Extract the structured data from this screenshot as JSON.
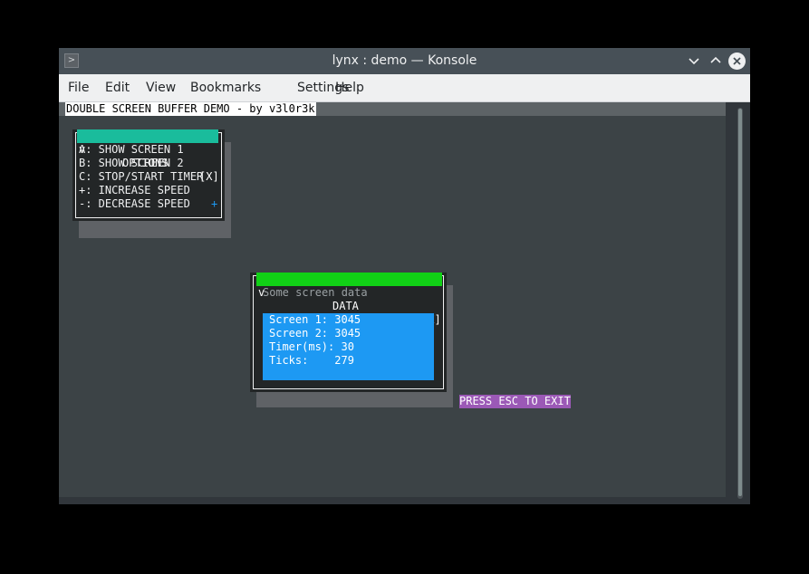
{
  "window": {
    "title": "lynx : demo — Konsole",
    "app_icon": "terminal-prompt-icon",
    "min_icon": "chevron-down-icon",
    "max_icon": "chevron-up-icon",
    "close_label": "✕",
    "min_label": "⌄",
    "max_label": "⌃"
  },
  "menu": [
    "File",
    "Edit",
    "View",
    "Bookmarks",
    "Settings",
    "Help"
  ],
  "terminal": {
    "banner": "DOUBLE SCREEN BUFFER DEMO - by v3l0r3k",
    "options_panel": {
      "title_left": "v",
      "title": "OPTIONS",
      "title_right": "[X]",
      "accent_color": "#1abc9c",
      "items": [
        "A: SHOW SCREEN 1",
        "B: SHOW SCREEN 2",
        "C: STOP/START TIMER",
        "+: INCREASE SPEED",
        "-: DECREASE SPEED"
      ],
      "marker": "+"
    },
    "data_panel": {
      "title_left": "v",
      "title": "DATA",
      "title_right": "[X]",
      "accent_color": "#11d116",
      "subtitle": "Some screen data",
      "box_color": "#1d99f3",
      "rows": [
        "Screen 1: 3045",
        "Screen 2: 3045",
        "Timer(ms): 30",
        "Ticks:    279"
      ]
    },
    "exit_hint": "PRESS ESC TO EXIT",
    "exit_color": "#9b59b6"
  }
}
